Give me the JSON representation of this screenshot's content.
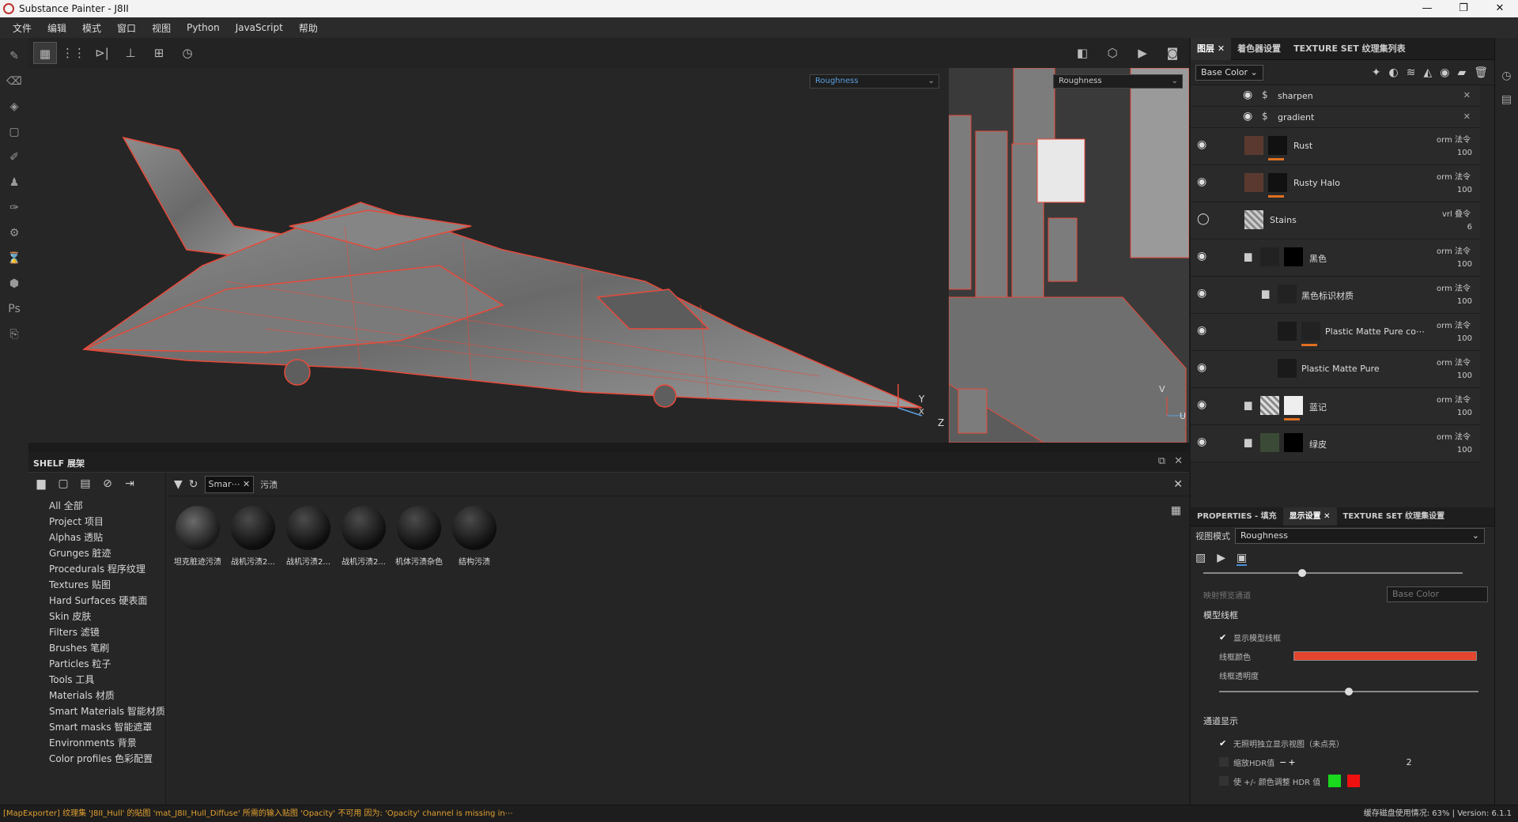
{
  "window": {
    "title": "Substance Painter - J8II",
    "min": "—",
    "max": "❐",
    "close": "✕"
  },
  "menu": [
    "文件",
    "编辑",
    "模式",
    "窗口",
    "视图",
    "Python",
    "JavaScript",
    "帮助"
  ],
  "viewport": {
    "left_dropdown": "Roughness",
    "right_dropdown": "Roughness",
    "axis_y": "Y",
    "axis_x": "X",
    "axis_z": "Z",
    "uv_v": "V",
    "uv_u": "U"
  },
  "shelf": {
    "title": "SHELF 展架",
    "categories": [
      "All 全部",
      "Project 项目",
      "Alphas 透贴",
      "Grunges 脏迹",
      "Procedurals 程序纹理",
      "Textures 贴图",
      "Hard Surfaces 硬表面",
      "Skin 皮肤",
      "Filters 滤镜",
      "Brushes 笔刷",
      "Particles 粒子",
      "Tools 工具",
      "Materials 材质",
      "Smart Materials 智能材质",
      "Smart masks 智能遮罩",
      "Environments 背景",
      "Color profiles 色彩配置"
    ],
    "filter_chip": "Smar⋯",
    "search_value": "污渍",
    "materials": [
      "坦克脏迹污渍",
      "战机污渍2...",
      "战机污渍2...",
      "战机污渍2...",
      "机体污渍杂色",
      "结构污渍"
    ]
  },
  "layers_panel": {
    "tabs": [
      "图层",
      "着色器设置",
      "TEXTURE SET 纹理集列表"
    ],
    "channel": "Base Color",
    "layers": [
      {
        "name": "sharpen",
        "type": "sub"
      },
      {
        "name": "gradient",
        "type": "sub"
      },
      {
        "name": "Rust",
        "blend": "orm 法令",
        "opacity": "100"
      },
      {
        "name": "Rusty Halo",
        "blend": "orm 法令",
        "opacity": "100"
      },
      {
        "name": "Stains",
        "blend": "vrl 叠令",
        "opacity": "6"
      },
      {
        "name": "黑色",
        "blend": "orm 法令",
        "opacity": "100"
      },
      {
        "name": "黑色标识材质",
        "blend": "orm 法令",
        "opacity": "100"
      },
      {
        "name": "Plastic Matte Pure co⋯",
        "blend": "orm 法令",
        "opacity": "100"
      },
      {
        "name": "Plastic Matte Pure",
        "blend": "orm 法令",
        "opacity": "100"
      },
      {
        "name": "蓝记",
        "blend": "orm 法令",
        "opacity": "100"
      },
      {
        "name": "绿皮",
        "blend": "orm 法令",
        "opacity": "100"
      }
    ]
  },
  "properties": {
    "tabs": [
      "PROPERTIES - 填充",
      "显示设置",
      "TEXTURE SET 纹理集设置"
    ],
    "view_mode_label": "视图模式",
    "view_mode_value": "Roughness",
    "preview_channel_label": "映射预览通道",
    "preview_channel_value": "Base Color",
    "wireframe_section": "模型线框",
    "show_wireframe": "显示模型线框",
    "wire_color_label": "线框颜色",
    "wire_color": "#e3452f",
    "wire_opacity_label": "线框透明度",
    "wire_opacity": 0.5,
    "channel_section": "通道显示",
    "isolate_label": "无照明独立显示视图（未点亮）",
    "hdr_label": "缩放HDR值",
    "hdr_value": "2",
    "hdr_adjust_label": "使 +/- 颜色调整 HDR 值"
  },
  "status": {
    "message": "[MapExporter] 纹理集 'J8II_Hull' 的贴图 'mat_J8II_Hull_Diffuse' 所需的输入贴图 'Opacity' 不可用 因为: 'Opacity' channel is missing in⋯",
    "disk": "缓存磁盘使用情况: 63%",
    "version": "Version: 6.1.1"
  }
}
